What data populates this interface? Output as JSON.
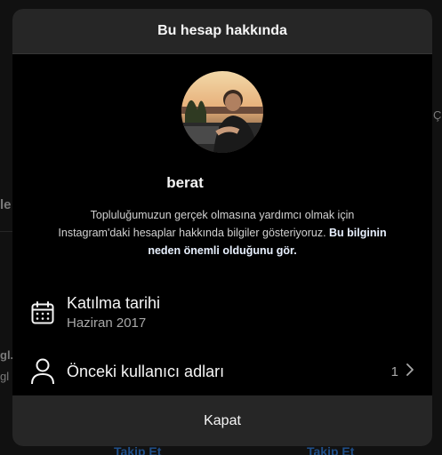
{
  "background": {
    "fragments": [
      "le",
      "gl.",
      "gl",
      "Ç",
      "Takip Et",
      "Takip Et"
    ]
  },
  "modal": {
    "title": "Bu hesap hakkında",
    "username": "berat",
    "description": "Topluluğumuzun gerçek olmasına yardımcı olmak için Instagram'daki hesaplar hakkında bilgiler gösteriyoruz.",
    "description_link": "Bu bilginin neden önemli olduğunu gör.",
    "join_date": {
      "icon": "calendar-icon",
      "label": "Katılma tarihi",
      "value": "Haziran 2017"
    },
    "former_usernames": {
      "icon": "person-icon",
      "label": "Önceki kullanıcı adları",
      "count": "1"
    },
    "close_label": "Kapat"
  },
  "colors": {
    "modal_bg": "#000000",
    "header_bg": "#262626",
    "text_primary": "#f5f5f5",
    "text_secondary": "#a8a8a8"
  }
}
